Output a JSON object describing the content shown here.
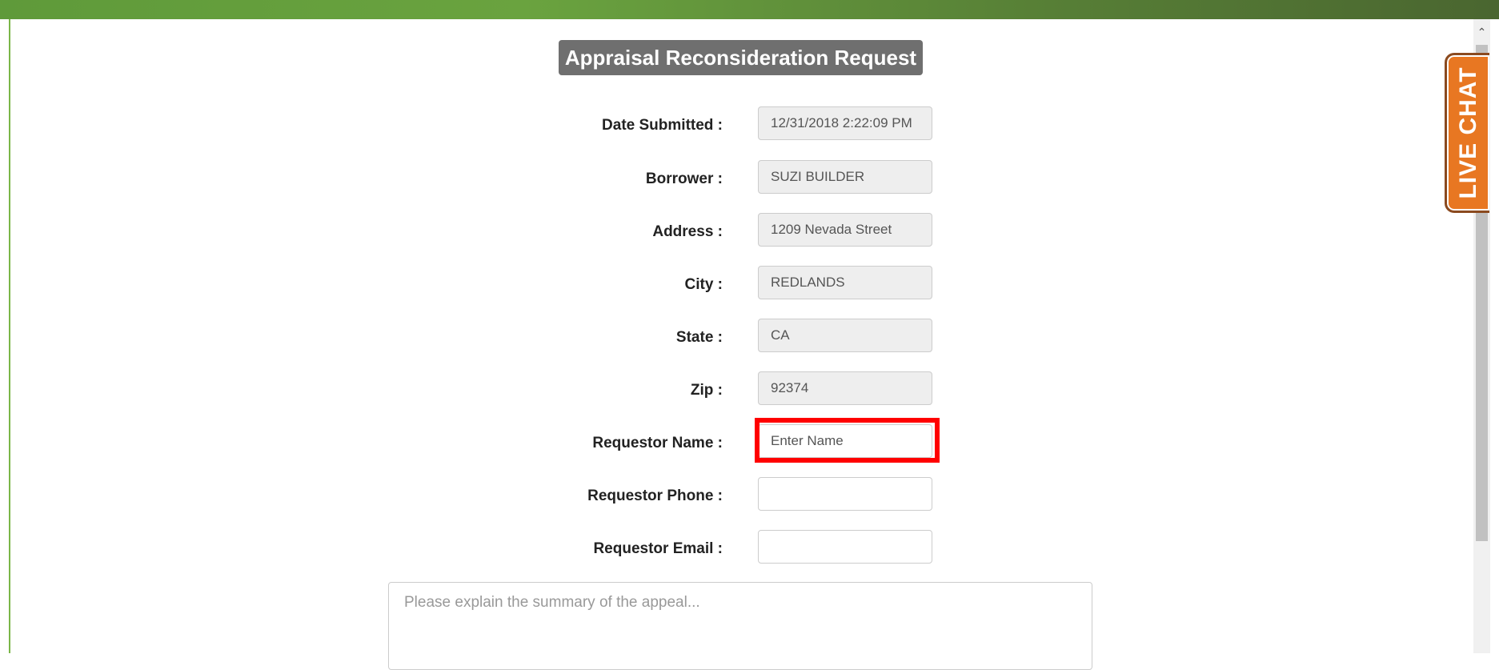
{
  "title": "Appraisal Reconsideration Request",
  "fields": [
    {
      "label": "Date Submitted :",
      "value": "12/31/2018 2:22:09 PM",
      "placeholder": "",
      "readonly": true
    },
    {
      "label": "Borrower :",
      "value": "SUZI BUILDER",
      "placeholder": "",
      "readonly": true
    },
    {
      "label": "Address :",
      "value": "1209 Nevada Street",
      "placeholder": "",
      "readonly": true
    },
    {
      "label": "City :",
      "value": "REDLANDS",
      "placeholder": "",
      "readonly": true
    },
    {
      "label": "State :",
      "value": "CA",
      "placeholder": "",
      "readonly": true
    },
    {
      "label": "Zip :",
      "value": "92374",
      "placeholder": "",
      "readonly": true
    },
    {
      "label": "Requestor Name :",
      "value": "",
      "placeholder": "Enter Name",
      "readonly": false
    },
    {
      "label": "Requestor Phone :",
      "value": "",
      "placeholder": "",
      "readonly": false
    },
    {
      "label": "Requestor Email :",
      "value": "",
      "placeholder": "",
      "readonly": false
    }
  ],
  "summary": {
    "placeholder": "Please explain the summary of the appeal..."
  },
  "live_chat": {
    "label": "LIVE CHAT",
    "color": "#e87722"
  },
  "scrollbar": {
    "up_arrow_icon": "chevron-up-icon"
  },
  "colors": {
    "header_bar": "#6aa33f",
    "title_badge": "#6f6f6f",
    "highlight": "#ff0000"
  }
}
